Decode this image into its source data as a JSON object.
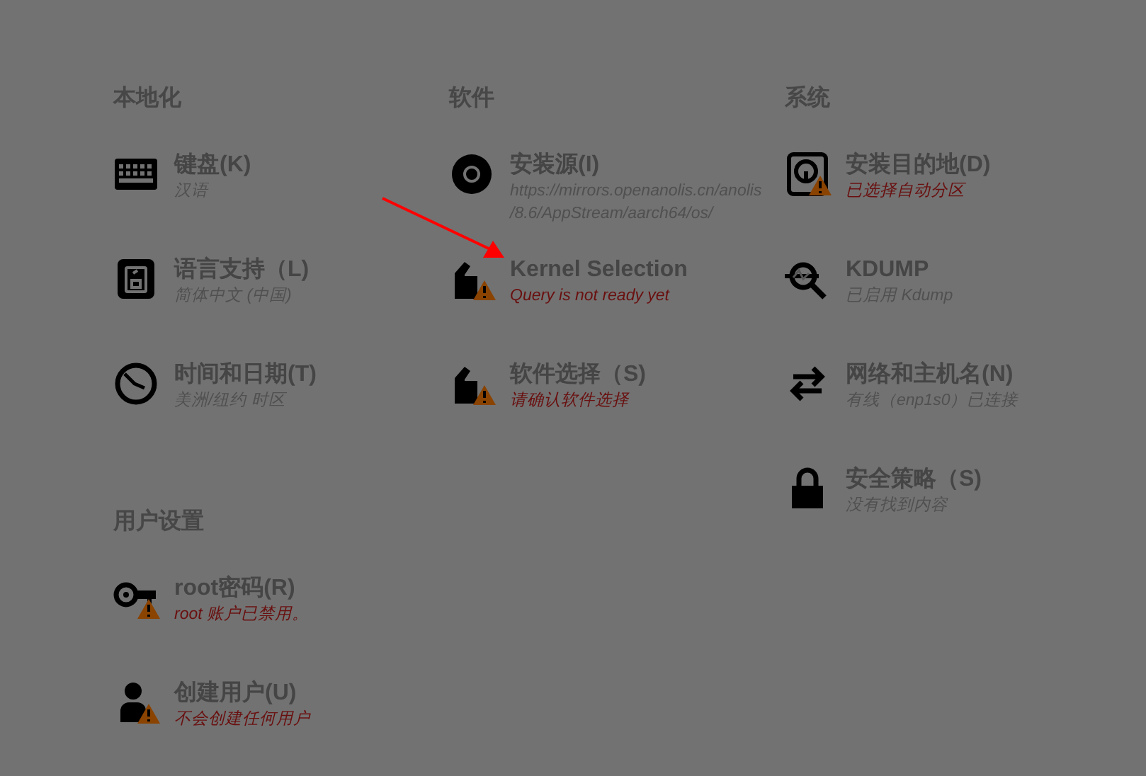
{
  "columns": [
    {
      "sections": [
        {
          "heading": "本地化",
          "items": [
            {
              "kind": "keyboard",
              "title": "键盘(K)",
              "subtitle": "汉语",
              "warning": false,
              "attention": false
            },
            {
              "kind": "language",
              "title": "语言支持（L)",
              "subtitle": "简体中文 (中国)",
              "warning": false,
              "attention": false
            },
            {
              "kind": "clock",
              "title": "时间和日期(T)",
              "subtitle": "美洲/纽约 时区",
              "warning": false,
              "attention": false
            }
          ]
        },
        {
          "heading": "用户设置",
          "items": [
            {
              "kind": "key",
              "title": "root密码(R)",
              "subtitle": "root 账户已禁用。",
              "warning": true,
              "attention": true
            },
            {
              "kind": "user",
              "title": "创建用户(U)",
              "subtitle": "不会创建任何用户",
              "warning": true,
              "attention": true
            }
          ]
        }
      ]
    },
    {
      "sections": [
        {
          "heading": "软件",
          "items": [
            {
              "kind": "disc",
              "title": "安装源(I)",
              "subtitle": "https://mirrors.openanolis.cn/anolis/8.6/AppStream/aarch64/os/",
              "warning": false,
              "attention": false
            },
            {
              "kind": "package",
              "title": "Kernel Selection",
              "subtitle": "Query is not ready yet",
              "warning": true,
              "attention": true
            },
            {
              "kind": "package",
              "title": "软件选择（S)",
              "subtitle": "请确认软件选择",
              "warning": true,
              "attention": true
            }
          ]
        }
      ]
    },
    {
      "sections": [
        {
          "heading": "系统",
          "items": [
            {
              "kind": "drive",
              "title": "安装目的地(D)",
              "subtitle": "已选择自动分区",
              "warning": true,
              "attention": true
            },
            {
              "kind": "kdump",
              "title": "KDUMP",
              "subtitle": "已启用 Kdump",
              "warning": false,
              "attention": false
            },
            {
              "kind": "network",
              "title": "网络和主机名(N)",
              "subtitle": "有线（enp1s0）已连接",
              "warning": false,
              "attention": false
            },
            {
              "kind": "lock",
              "title": "安全策略（S)",
              "subtitle": "没有找到内容",
              "warning": false,
              "attention": false
            }
          ]
        }
      ]
    }
  ]
}
